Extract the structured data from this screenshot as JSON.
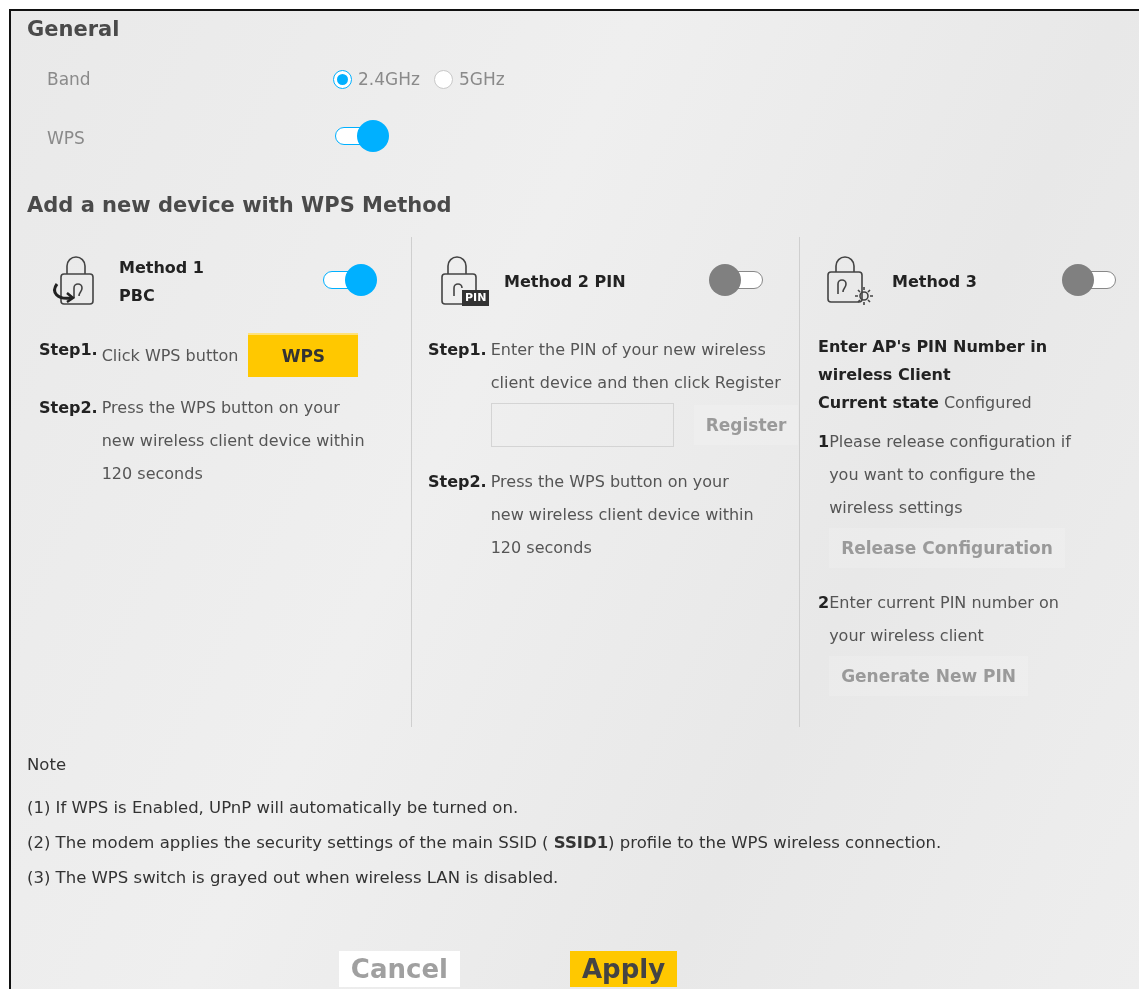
{
  "general": {
    "title": "General",
    "band": {
      "label": "Band",
      "options": [
        {
          "label": "2.4GHz",
          "selected": true
        },
        {
          "label": "5GHz",
          "selected": false
        }
      ]
    },
    "wps": {
      "label": "WPS",
      "on": true
    }
  },
  "methods_title": "Add a new device with WPS Method",
  "methods": [
    {
      "kind": "pbc",
      "title": "Method 1 PBC",
      "on": true,
      "steps": [
        {
          "label": "Step1.",
          "text": "Click WPS button",
          "button": "WPS"
        },
        {
          "label": "Step2.",
          "text": "Press the WPS button on your new wireless client device within 120 seconds"
        }
      ]
    },
    {
      "kind": "pin",
      "title": "Method 2 PIN",
      "icon_badge": "PIN",
      "on": false,
      "steps": [
        {
          "label": "Step1.",
          "text": "Enter the PIN of your new wireless client device and then click Register",
          "button": "Register",
          "disabled": true
        },
        {
          "label": "Step2.",
          "text": "Press the WPS button on your new wireless client device within 120 seconds"
        }
      ]
    },
    {
      "kind": "ap_pin",
      "title": "Method 3",
      "on": false,
      "heading": "Enter AP's PIN Number in wireless Client",
      "state_label": "Current state",
      "state_value": "Configured",
      "items": [
        {
          "number": "1",
          "text": "Please release configuration if you want to configure the wireless settings",
          "button": "Release Configuration",
          "disabled": true
        },
        {
          "number": "2",
          "text": "Enter current PIN number on your wireless client",
          "button": "Generate New PIN",
          "disabled": true
        }
      ]
    }
  ],
  "notes": {
    "title": "Note",
    "lines": [
      "(1) If WPS is Enabled, UPnP will automatically be turned on.",
      "(2) The modem applies the security settings of the main SSID ( **SSID1**) profile to the WPS wireless connection.",
      "(3) The WPS switch is grayed out when wireless LAN is disabled."
    ]
  },
  "buttons": [
    {
      "kind": "cancel",
      "label": "Cancel"
    },
    {
      "kind": "apply",
      "label": "Apply"
    }
  ]
}
